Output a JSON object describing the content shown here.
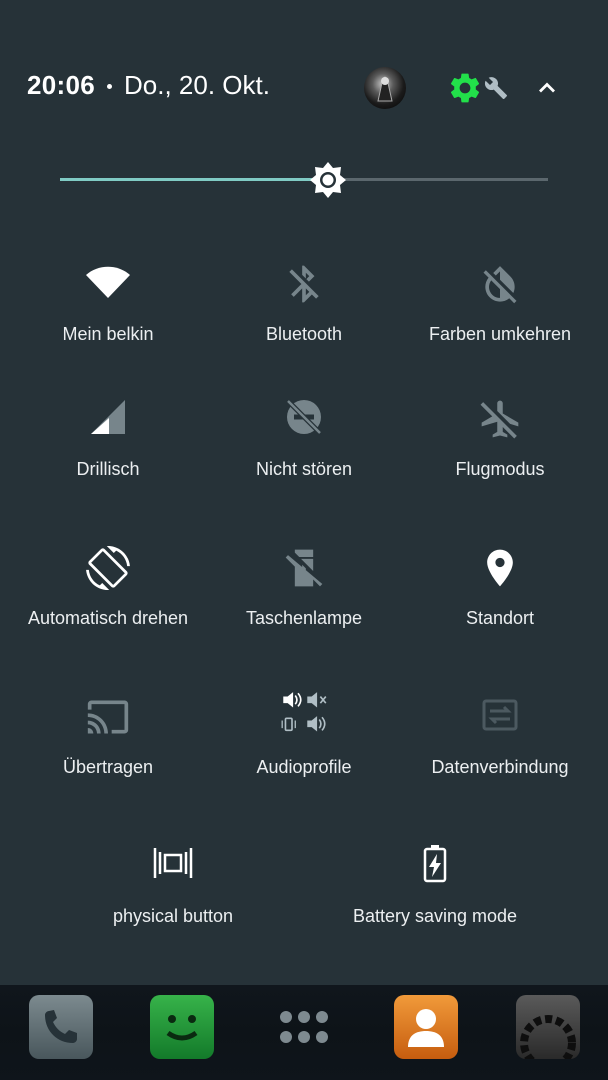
{
  "status": {
    "time": "20:06",
    "date": "Do., 20. Okt."
  },
  "brightness": {
    "level": 0.55
  },
  "tiles": [
    {
      "label": "Mein belkin",
      "icon": "wifi-icon",
      "active": true
    },
    {
      "label": "Bluetooth",
      "icon": "bluetooth-off-icon",
      "active": false
    },
    {
      "label": "Farben umkehren",
      "icon": "invert-colors-icon",
      "active": false
    },
    {
      "label": "Drillisch",
      "icon": "cell-signal-icon",
      "active": true
    },
    {
      "label": "Nicht stören",
      "icon": "do-not-disturb-icon",
      "active": false
    },
    {
      "label": "Flugmodus",
      "icon": "airplane-off-icon",
      "active": false
    },
    {
      "label": "Automatisch drehen",
      "icon": "auto-rotate-icon",
      "active": true
    },
    {
      "label": "Taschenlampe",
      "icon": "flashlight-off-icon",
      "active": false
    },
    {
      "label": "Standort",
      "icon": "location-icon",
      "active": true
    },
    {
      "label": "Übertragen",
      "icon": "cast-icon",
      "active": false
    },
    {
      "label": "Audioprofile",
      "icon": "audio-profiles-icon",
      "active": true
    },
    {
      "label": "Datenverbindung",
      "icon": "data-connection-icon",
      "active": false
    },
    {
      "label": "physical button",
      "icon": "physical-button-icon",
      "active": true
    },
    {
      "label": "Battery saving mode",
      "icon": "battery-saver-icon",
      "active": true
    }
  ],
  "dock": {
    "apps": [
      "phone-app-icon",
      "messaging-app-icon",
      "app-drawer-icon",
      "contacts-app-icon",
      "settings-app-icon"
    ]
  },
  "colors": {
    "background": "#263238",
    "accent": "#80CBC4",
    "settings_gear": "#22E04A",
    "active_icon": "#FFFFFF",
    "inactive_icon": "#77858B"
  }
}
